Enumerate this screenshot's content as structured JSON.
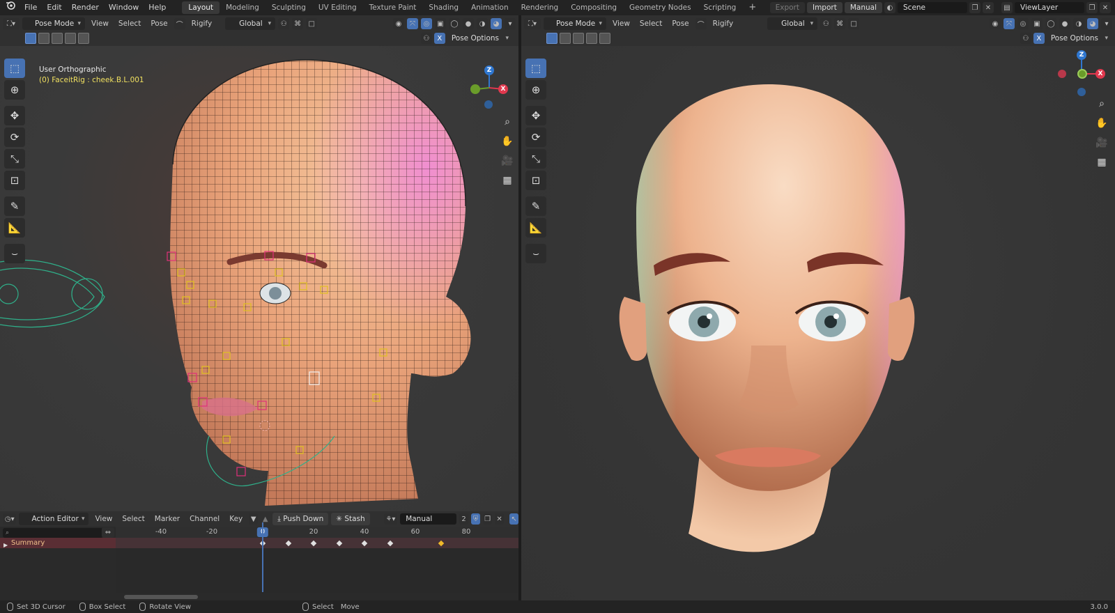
{
  "topbar": {
    "menus": [
      "File",
      "Edit",
      "Render",
      "Window",
      "Help"
    ],
    "workspaces": [
      "Layout",
      "Modeling",
      "Sculpting",
      "UV Editing",
      "Texture Paint",
      "Shading",
      "Animation",
      "Rendering",
      "Compositing",
      "Geometry Nodes",
      "Scripting"
    ],
    "active_workspace": "Layout",
    "add_tab": "+",
    "export": "Export",
    "import": "Import",
    "manual": "Manual",
    "scene": "Scene",
    "view_layer": "ViewLayer"
  },
  "left_viewport": {
    "mode": "Pose Mode",
    "menus": [
      "View",
      "Select",
      "Pose"
    ],
    "rigify": "Rigify",
    "orientation": "Global",
    "pose_options": "Pose Options",
    "x_label": "X",
    "view_name": "User Orthographic",
    "object_info": "(0) FaceitRig : cheek.B.L.001"
  },
  "right_viewport": {
    "mode": "Pose Mode",
    "menus": [
      "View",
      "Select",
      "Pose"
    ],
    "rigify": "Rigify",
    "orientation": "Global",
    "pose_options": "Pose Options",
    "x_label": "X"
  },
  "axes": {
    "z": "Z",
    "x": "X"
  },
  "action_editor": {
    "mode": "Action Editor",
    "menus": [
      "View",
      "Select",
      "Marker",
      "Channel",
      "Key"
    ],
    "push_down": "Push Down",
    "stash": "Stash",
    "action": "Manual",
    "users": "2",
    "current_frame": "0",
    "ticks": [
      "-40",
      "-20",
      "20",
      "40",
      "60",
      "80"
    ],
    "summary": "Summary",
    "keyframes": [
      0,
      10,
      20,
      30,
      40,
      50,
      70
    ],
    "selected_keyframe": 70
  },
  "status": {
    "set_cursor": "Set 3D Cursor",
    "box_select": "Box Select",
    "rotate": "Rotate View",
    "select": "Select",
    "move": "Move",
    "version": "3.0.0"
  },
  "colors": {
    "accent": "#4772b3",
    "keyframe_selected": "#f0b92a",
    "axis_x": "#e0384e",
    "axis_y": "#6a9c2a",
    "axis_z": "#2f77d0"
  }
}
